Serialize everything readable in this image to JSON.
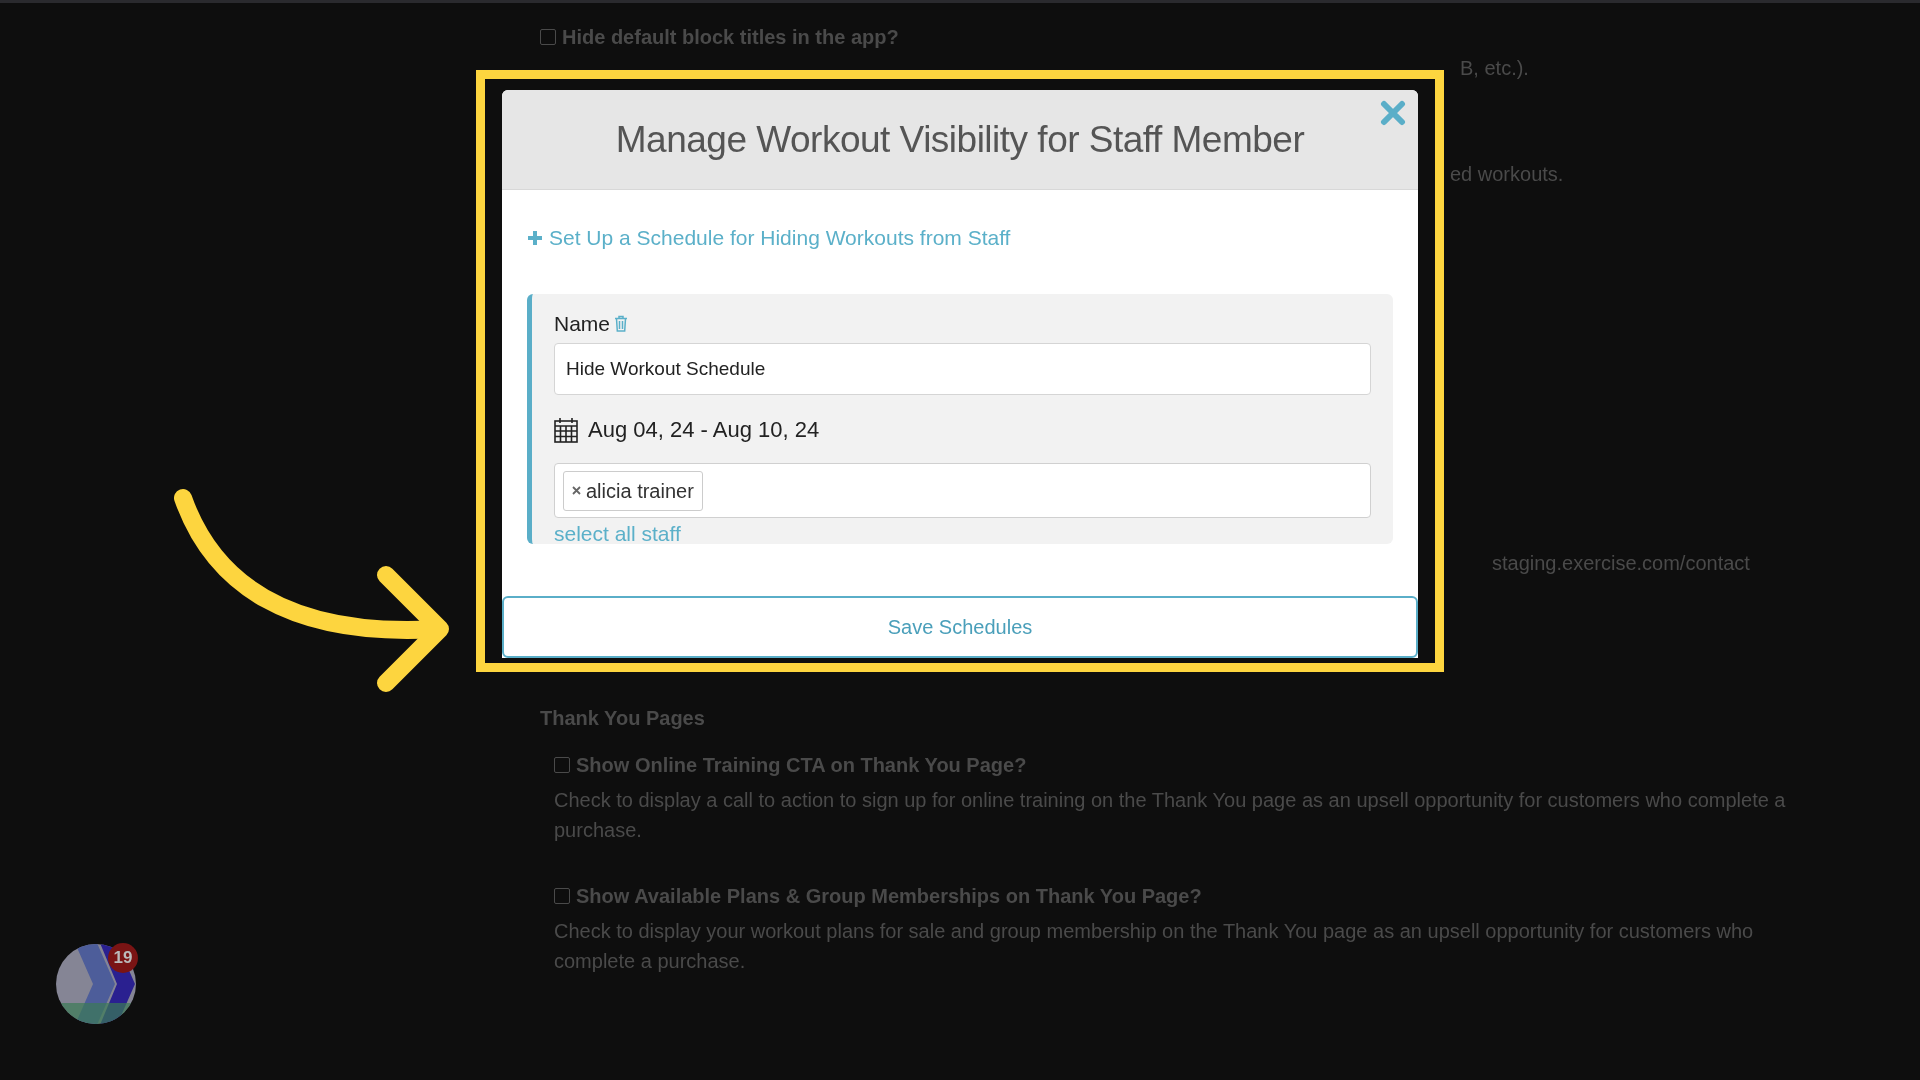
{
  "background_page": {
    "settings": [
      {
        "kind": "checkbox",
        "label": "Hide default block titles in the app?",
        "checked": false
      }
    ],
    "fragments": [
      "B, etc.).",
      "ed workouts.",
      "staging.exercise.com/contact"
    ],
    "section_title": "Thank You Pages",
    "options": [
      {
        "label": "Show Online Training CTA on Thank You Page?",
        "description": "Check to display a call to action to sign up for online training on the Thank You page as an upsell opportunity for customers who complete a purchase.",
        "checked": false
      },
      {
        "label": "Show Available Plans & Group Memberships on Thank You Page?",
        "description": "Check to display your workout plans for sale and group membership on the Thank You page as an upsell opportunity for customers who complete a purchase.",
        "checked": false
      }
    ]
  },
  "modal": {
    "title": "Manage Workout Visibility for Staff Member",
    "add_link": "Set Up a Schedule for Hiding Workouts from Staff",
    "schedules": [
      {
        "name_label": "Name",
        "name_value": "Hide Workout Schedule",
        "date_range": "Aug 04, 24 - Aug 10, 24",
        "staff": [
          {
            "label": "alicia trainer"
          }
        ],
        "select_all_link": "select all staff"
      }
    ],
    "save_button": "Save Schedules"
  },
  "notification_badge": "19"
}
